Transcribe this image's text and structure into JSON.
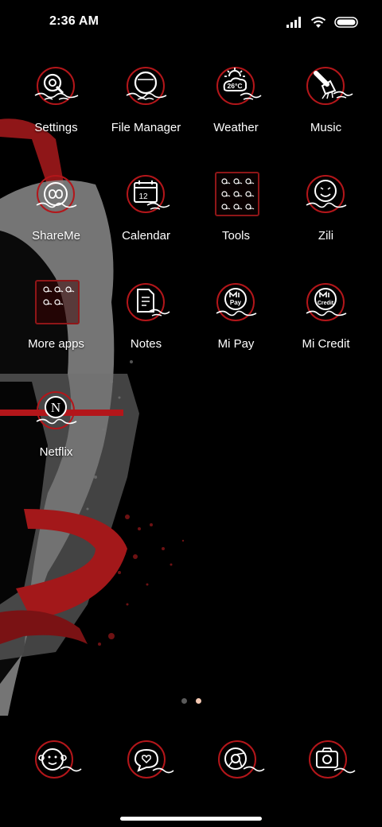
{
  "status_bar": {
    "time": "2:36 AM"
  },
  "home": {
    "apps": [
      {
        "id": "settings",
        "label": "Settings",
        "icon": "gear-icon"
      },
      {
        "id": "file-manager",
        "label": "File Manager",
        "icon": "folder-icon"
      },
      {
        "id": "weather",
        "label": "Weather",
        "icon": "weather-icon",
        "icon_text": "26°C"
      },
      {
        "id": "music",
        "label": "Music",
        "icon": "music-icon"
      },
      {
        "id": "shareme",
        "label": "ShareMe",
        "icon": "infinity-icon"
      },
      {
        "id": "calendar",
        "label": "Calendar",
        "icon": "calendar-icon",
        "icon_text": "12"
      },
      {
        "id": "tools",
        "label": "Tools",
        "icon": "folder-grid-icon"
      },
      {
        "id": "zili",
        "label": "Zili",
        "icon": "face-icon"
      },
      {
        "id": "more-apps",
        "label": "More apps",
        "icon": "folder-grid-icon"
      },
      {
        "id": "notes",
        "label": "Notes",
        "icon": "note-icon"
      },
      {
        "id": "mi-pay",
        "label": "Mi Pay",
        "icon": "mi-pay-icon",
        "icon_text": "Pay"
      },
      {
        "id": "mi-credit",
        "label": "Mi Credit",
        "icon": "mi-credit-icon",
        "icon_text": "Credit"
      },
      {
        "id": "netflix",
        "label": "Netflix",
        "icon": "netflix-icon",
        "icon_text": "N"
      }
    ]
  },
  "dock": [
    {
      "id": "dock-monkey",
      "icon": "monkey-icon"
    },
    {
      "id": "dock-messages",
      "icon": "message-heart-icon"
    },
    {
      "id": "dock-chrome",
      "icon": "chrome-icon"
    },
    {
      "id": "dock-camera",
      "icon": "camera-icon"
    }
  ],
  "pager": {
    "pages": 2,
    "current": 2
  },
  "colors": {
    "accent_red": "#b3161a",
    "dot_active": "#f4c9b3",
    "dot_inactive": "#5a5a5a"
  }
}
